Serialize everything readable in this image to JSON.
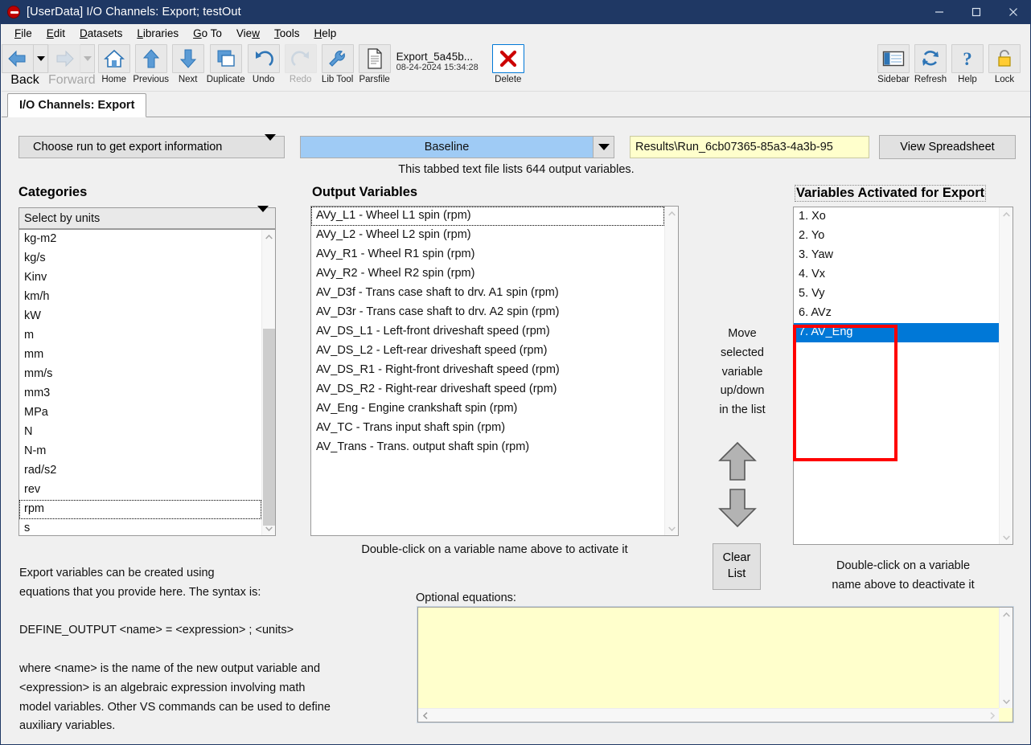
{
  "window": {
    "title": "[UserData] I/O Channels: Export; testOut",
    "app_icon": "vs-circle-icon",
    "controls": {
      "minimize": "minimize-icon",
      "maximize": "maximize-icon",
      "close": "close-icon"
    },
    "titlebar_color": "#1f3864"
  },
  "menu": [
    {
      "label": "File",
      "accel": "F"
    },
    {
      "label": "Edit",
      "accel": "E"
    },
    {
      "label": "Datasets",
      "accel": "D"
    },
    {
      "label": "Libraries",
      "accel": "L"
    },
    {
      "label": "Go To",
      "accel": "G"
    },
    {
      "label": "View",
      "accel": "w"
    },
    {
      "label": "Tools",
      "accel": "T"
    },
    {
      "label": "Help",
      "accel": "H"
    }
  ],
  "toolbar": {
    "left": [
      {
        "label": "Back",
        "icon": "back-arrow-icon",
        "disabled": false,
        "dropdown": true
      },
      {
        "label": "Forward",
        "icon": "forward-arrow-icon",
        "disabled": true,
        "dropdown": true
      },
      {
        "label": "Home",
        "icon": "home-icon",
        "disabled": false
      },
      {
        "label": "Previous",
        "icon": "up-arrow-icon",
        "disabled": false
      },
      {
        "label": "Next",
        "icon": "down-arrow-icon",
        "disabled": false
      },
      {
        "label": "Duplicate",
        "icon": "duplicate-icon",
        "disabled": false
      },
      {
        "label": "Undo",
        "icon": "undo-icon",
        "disabled": false
      },
      {
        "label": "Redo",
        "icon": "redo-icon",
        "disabled": true
      },
      {
        "label": "Lib Tool",
        "icon": "wrench-icon",
        "disabled": false
      },
      {
        "label": "Parsfile",
        "icon": "document-icon",
        "disabled": false
      }
    ],
    "parsfile": {
      "name": "Export_5a45b...",
      "timestamp": "08-24-2024 15:34:28"
    },
    "delete": {
      "label": "Delete",
      "icon": "red-x-icon"
    },
    "right": [
      {
        "label": "Sidebar",
        "icon": "sidebar-icon"
      },
      {
        "label": "Refresh",
        "icon": "refresh-icon"
      },
      {
        "label": "Help",
        "icon": "question-mark-icon"
      },
      {
        "label": "Lock",
        "icon": "padlock-icon"
      }
    ]
  },
  "tab": {
    "label": "I/O Channels: Export"
  },
  "topbar": {
    "choose_run_label": "Choose run to get export information",
    "run_value": "Baseline",
    "results_path": "Results\\Run_6cb07365-85a3-4a3b-95",
    "view_spreadsheet_label": "View Spreadsheet",
    "file_note": "This tabbed text file lists 644 output variables."
  },
  "categories": {
    "title": "Categories",
    "select_label": "Select by units",
    "items": [
      "kg-m2",
      "kg/s",
      "Kinv",
      "km/h",
      "kW",
      "m",
      "mm",
      "mm/s",
      "mm3",
      "MPa",
      "N",
      "N-m",
      "rad/s2",
      "rev",
      "rpm",
      "s"
    ],
    "focused": "rpm"
  },
  "output_variables": {
    "title": "Output Variables",
    "items": [
      "AVy_L1 - Wheel L1 spin (rpm)",
      "AVy_L2 - Wheel L2 spin (rpm)",
      "AVy_R1 - Wheel R1 spin (rpm)",
      "AVy_R2 - Wheel R2 spin (rpm)",
      "AV_D3f - Trans case shaft to drv. A1 spin (rpm)",
      "AV_D3r - Trans case shaft to drv. A2 spin (rpm)",
      "AV_DS_L1 - Left-front driveshaft speed (rpm)",
      "AV_DS_L2 - Left-rear driveshaft speed (rpm)",
      "AV_DS_R1 - Right-front driveshaft speed (rpm)",
      "AV_DS_R2 - Right-rear driveshaft speed (rpm)",
      "AV_Eng - Engine crankshaft spin (rpm)",
      "AV_TC - Trans input shaft spin (rpm)",
      "AV_Trans - Trans. output shaft spin (rpm)"
    ],
    "focused": "AVy_L1 - Wheel L1 spin (rpm)",
    "hint": "Double-click on a variable name above to activate it"
  },
  "move_panel": {
    "text": "Move\nselected\nvariable\nup/down\nin the list",
    "up_icon": "fat-up-arrow-icon",
    "down_icon": "fat-down-arrow-icon",
    "clear_list_label": "Clear\nList"
  },
  "activated": {
    "title": "Variables Activated for Export",
    "items": [
      "1. Xo",
      "2. Yo",
      "3. Yaw",
      "4. Vx",
      "5. Vy",
      "6. AVz",
      "7. AV_Eng"
    ],
    "selected": "7. AV_Eng",
    "hint": "Double-click on a variable\nname above to deactivate it",
    "highlight_color": "#ff0000",
    "selection_color": "#0078d7"
  },
  "help_text": "Export variables can be created using\nequations that you provide here. The syntax is:\n\nDEFINE_OUTPUT <name> = <expression> ; <units>\n\nwhere <name> is the name of the new output variable and\n<expression> is an algebraic expression involving math\nmodel variables. Other VS commands can be used to define\nauxiliary variables.",
  "equations": {
    "label": "Optional equations:",
    "value": "",
    "placeholder": ""
  },
  "colors": {
    "accent_blue": "#0078d7",
    "combo_blue": "#9fcbf5",
    "yellow_field": "#ffffcc",
    "annotation_red": "#ff0000",
    "titlebar": "#1f3864"
  }
}
